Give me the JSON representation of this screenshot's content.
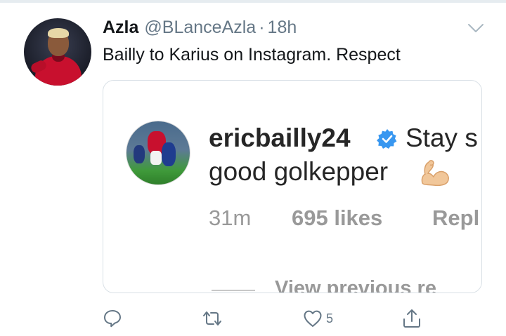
{
  "tweet": {
    "author_name": "Azla",
    "author_handle": "@BLanceAzla",
    "separator": "·",
    "timestamp": "18h",
    "text": "Bailly to Karius on Instagram. Respect"
  },
  "instagram": {
    "username": "ericbailly24",
    "comment_line_1": "Stay s",
    "comment_line_2": "good golkepper",
    "emoji": "flexed-biceps",
    "time": "31m",
    "likes": "695 likes",
    "reply": "Repl",
    "view_previous": "View previous re"
  },
  "actions": {
    "likes_count": "5"
  },
  "icons": {
    "caret": "chevron-down-icon",
    "verified": "verified-badge-icon",
    "reply": "reply-icon",
    "retweet": "retweet-icon",
    "like": "heart-icon",
    "share": "share-icon"
  },
  "colors": {
    "text": "#14171a",
    "secondary": "#657786",
    "instagram_text": "#262626",
    "instagram_meta": "#999999",
    "verified_blue": "#3897f0"
  }
}
